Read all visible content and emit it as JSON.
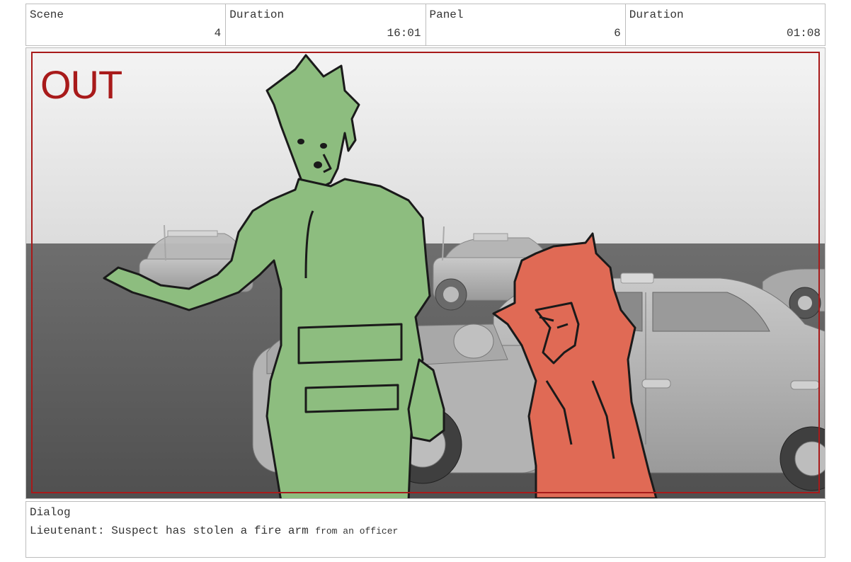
{
  "header": {
    "scene": {
      "label": "Scene",
      "value": "4"
    },
    "scene_duration": {
      "label": "Duration",
      "value": "16:01"
    },
    "panel": {
      "label": "Panel",
      "value": "6"
    },
    "panel_duration": {
      "label": "Duration",
      "value": "01:08"
    }
  },
  "frame": {
    "marker": "OUT",
    "marker_color": "#a81a1a",
    "character_left_color": "#8dbd7f",
    "character_right_color": "#e06a55"
  },
  "dialog": {
    "label": "Dialog",
    "line_main": "Lieutenant: Suspect has stolen a fire arm",
    "line_small": "from an officer"
  }
}
